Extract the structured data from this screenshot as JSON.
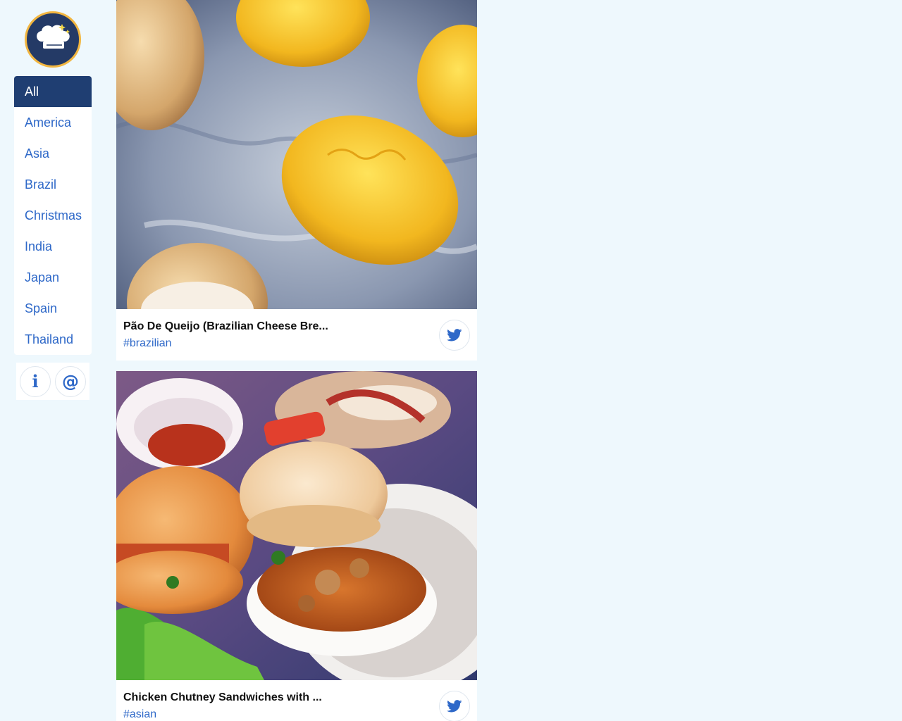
{
  "sidebar": {
    "logo_icon": "chef-hat-sparkle-icon",
    "items": [
      {
        "label": "All",
        "active": true
      },
      {
        "label": "America"
      },
      {
        "label": "Asia"
      },
      {
        "label": "Brazil"
      },
      {
        "label": "Christmas"
      },
      {
        "label": "India"
      },
      {
        "label": "Japan"
      },
      {
        "label": "Spain"
      },
      {
        "label": "Thailand"
      }
    ],
    "info_icon": "info-icon",
    "contact_icon": "at-sign-icon"
  },
  "feed": {
    "cards": [
      {
        "title": "Pão De Queijo (Brazilian Cheese Bre...",
        "tag": "#brazilian",
        "share_icon": "twitter-icon"
      },
      {
        "title": "Chicken Chutney Sandwiches with ...",
        "tag": "#asian",
        "share_icon": "twitter-icon"
      }
    ]
  },
  "colors": {
    "background": "#eef8fd",
    "accent": "#2e68c8",
    "active_nav": "#1f3e72",
    "logo_ring": "#f2b640"
  }
}
